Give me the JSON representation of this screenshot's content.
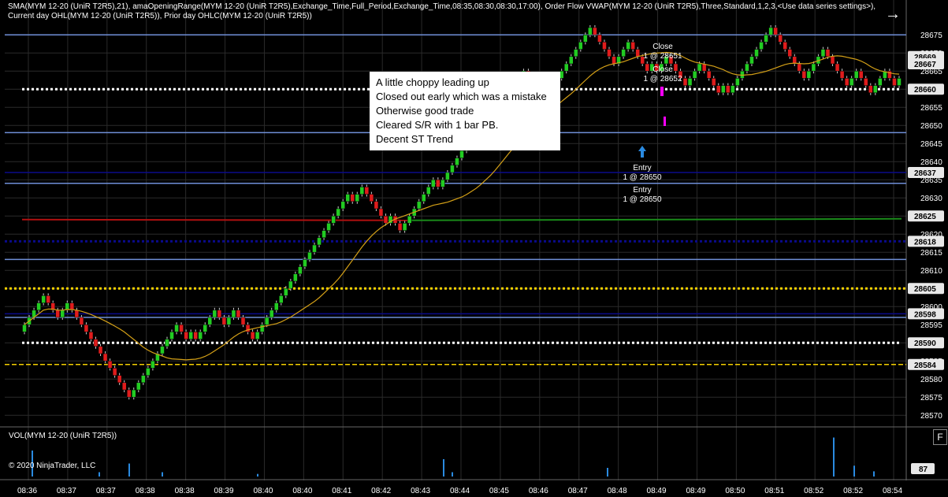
{
  "header": {
    "indicators": "SMA(MYM 12-20 (UniR T2R5),21), amaOpeningRange(MYM 12-20 (UniR T2R5),Exchange_Time,Full_Period,Exchange_Time,08:35,08:30,08:30,17:00), Order Flow VWAP(MYM 12-20 (UniR T2R5),Three,Standard,1,2,3,<Use data series settings>), Current day OHL(MYM 12-20 (UniR T2R5)), Prior day OHLC(MYM 12-20 (UniR T2R5))"
  },
  "volume_panel": {
    "label": "VOL(MYM 12-20 (UniR T2R5))",
    "last_value": "87",
    "f_button": "F"
  },
  "copyright": "© 2020 NinjaTrader, LLC",
  "note": {
    "lines": [
      "A little choppy leading up",
      "Closed out early which was a mistake",
      "Otherwise good trade",
      "Cleared S/R with 1 bar PB.",
      "Decent ST Trend"
    ]
  },
  "colors": {
    "up_candle": "#22cc22",
    "down_candle": "#e01c1c",
    "sma": "#d4a017",
    "level_line": "#6f8fd8",
    "dark_level": "#0a0a8a",
    "dotted_white": "#ffffff",
    "dotted_yellow": "#f5d000",
    "vwap_red": "#b01010",
    "vwap_green": "#1a8a1a",
    "volume_bar": "#2a8ae0",
    "entry_arrow": "#2a8ae0",
    "exit_marker": "#ff00ff"
  },
  "chart_data": {
    "type": "candlestick",
    "instrument": "MYM 12-20 (UniR T2R5)",
    "y_ticks": [
      28570,
      28575,
      28580,
      28585,
      28590,
      28595,
      28600,
      28605,
      28610,
      28615,
      28620,
      28625,
      28630,
      28635,
      28640,
      28645,
      28650,
      28655,
      28660,
      28665,
      28670,
      28675
    ],
    "ylim": [
      28567,
      28682
    ],
    "x_ticks": [
      "08:36",
      "08:37",
      "08:37",
      "08:38",
      "08:38",
      "08:39",
      "08:40",
      "08:40",
      "08:41",
      "08:42",
      "08:43",
      "08:44",
      "08:45",
      "08:46",
      "08:47",
      "08:48",
      "08:49",
      "08:49",
      "08:50",
      "08:51",
      "08:52",
      "08:52",
      "08:54"
    ],
    "bar_count": 185,
    "closes": [
      28595,
      28597,
      28599,
      28601,
      28603,
      28601,
      28599,
      28597,
      28599,
      28601,
      28599,
      28597,
      28595,
      28593,
      28591,
      28589,
      28587,
      28585,
      28583,
      28581,
      28579,
      28577,
      28575,
      28577,
      28579,
      28581,
      28583,
      28585,
      28587,
      28589,
      28591,
      28593,
      28595,
      28593,
      28591,
      28593,
      28591,
      28593,
      28595,
      28597,
      28599,
      28597,
      28595,
      28597,
      28599,
      28597,
      28595,
      28593,
      28591,
      28593,
      28595,
      28597,
      28599,
      28601,
      28603,
      28605,
      28607,
      28609,
      28611,
      28613,
      28615,
      28617,
      28619,
      28621,
      28623,
      28625,
      28627,
      28629,
      28631,
      28629,
      28631,
      28633,
      28631,
      28629,
      28627,
      28625,
      28623,
      28625,
      28623,
      28621,
      28623,
      28625,
      28627,
      28629,
      28631,
      28633,
      28635,
      28633,
      28635,
      28637,
      28639,
      28641,
      28643,
      28645,
      28647,
      28645,
      28647,
      28649,
      28651,
      28653,
      28655,
      28657,
      28659,
      28661,
      28663,
      28665,
      28663,
      28661,
      28659,
      28661,
      28659,
      28661,
      28663,
      28665,
      28667,
      28669,
      28671,
      28673,
      28675,
      28677,
      28675,
      28673,
      28671,
      28669,
      28667,
      28669,
      28671,
      28673,
      28671,
      28669,
      28667,
      28665,
      28667,
      28665,
      28667,
      28669,
      28667,
      28665,
      28663,
      28661,
      28663,
      28665,
      28667,
      28665,
      28663,
      28661,
      28659,
      28661,
      28659,
      28661,
      28663,
      28665,
      28667,
      28669,
      28671,
      28673,
      28675,
      28677,
      28675,
      28673,
      28671,
      28669,
      28667,
      28665,
      28663,
      28665,
      28667,
      28669,
      28671,
      28669,
      28667,
      28665,
      28663,
      28661,
      28663,
      28665,
      28663,
      28661,
      28659,
      28661,
      28663,
      28665,
      28663,
      28661,
      28663
    ],
    "volume": {
      "ylim": [
        0,
        100
      ],
      "values": {
        "40": 55,
        "93": 30,
        "97": 12,
        "122": 10,
        "125": 10,
        "165": 15,
        "175": 60,
        "185": 14,
        "200": 10,
        "200b": 7
      }
    },
    "levels": [
      {
        "price": 28675,
        "style": "solid",
        "color": "level_line"
      },
      {
        "price": 28648,
        "style": "solid",
        "color": "level_line"
      },
      {
        "price": 28637,
        "style": "solid",
        "color": "dark_level"
      },
      {
        "price": 28634,
        "style": "solid",
        "color": "level_line"
      },
      {
        "price": 28618,
        "style": "dotted",
        "color": "dark_level"
      },
      {
        "price": 28613,
        "style": "solid",
        "color": "level_line"
      },
      {
        "price": 28598,
        "style": "solid",
        "color": "dark_level"
      },
      {
        "price": 28597,
        "style": "solid",
        "color": "level_line"
      },
      {
        "price": 28584,
        "style": "dashed",
        "color": "dotted_yellow"
      },
      {
        "price": 28605,
        "style": "dotted",
        "color": "dotted_yellow"
      }
    ],
    "price_labels": [
      "28675",
      "28669",
      "28667",
      "28665",
      "28660",
      "28650",
      "28645",
      "28640",
      "28637",
      "28635",
      "28630",
      "28625",
      "28620",
      "28618",
      "28615",
      "28610",
      "28605",
      "28598",
      "28595",
      "28590",
      "28584",
      "28580",
      "28575",
      "28570"
    ],
    "highlight_labels": [
      "28669",
      "28667",
      "28660",
      "28637",
      "28625",
      "28618",
      "28605",
      "28598",
      "28590",
      "28584"
    ],
    "trades": {
      "close_1": {
        "label_a": "Close",
        "label_b": "1 @ 28651"
      },
      "close_2": {
        "label_a": "Close",
        "label_b": "1 @ 28652"
      },
      "entry_1": {
        "label_a": "Entry",
        "label_b": "1 @ 28650"
      },
      "entry_2": {
        "label_a": "Entry",
        "label_b": "1 @ 28650"
      }
    }
  }
}
